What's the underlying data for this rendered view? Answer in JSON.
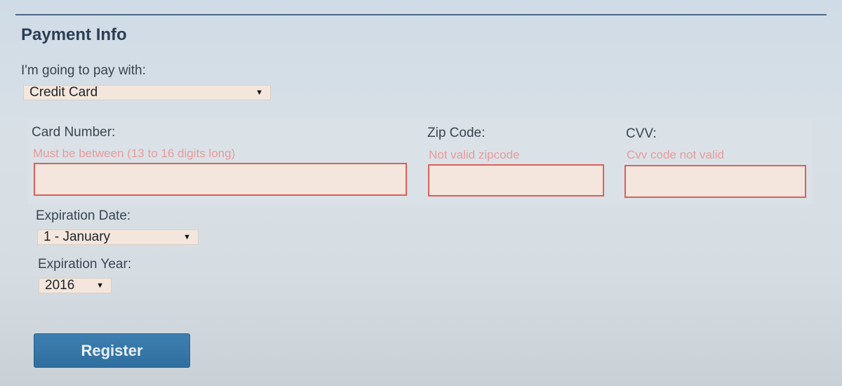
{
  "section": {
    "title": "Payment Info"
  },
  "payment_method": {
    "label": "I'm going to pay with:",
    "selected": "Credit Card"
  },
  "card_number": {
    "label": "Card Number:",
    "error": "Must be between (13 to 16 digits long)",
    "value": ""
  },
  "zip_code": {
    "label": "Zip Code:",
    "error": "Not valid zipcode",
    "value": ""
  },
  "cvv": {
    "label": "CVV:",
    "error": "Cvv code not valid",
    "value": ""
  },
  "expiration_date": {
    "label": "Expiration Date:",
    "selected": "1 - January"
  },
  "expiration_year": {
    "label": "Expiration Year:",
    "selected": "2016"
  },
  "register": {
    "label": "Register"
  },
  "colors": {
    "error_text": "#e89a9a",
    "error_border": "#d9605e",
    "button": "#3d7fb0",
    "input_bg": "#f4e6dc"
  },
  "icons": {
    "dropdown": "caret-down-icon"
  }
}
